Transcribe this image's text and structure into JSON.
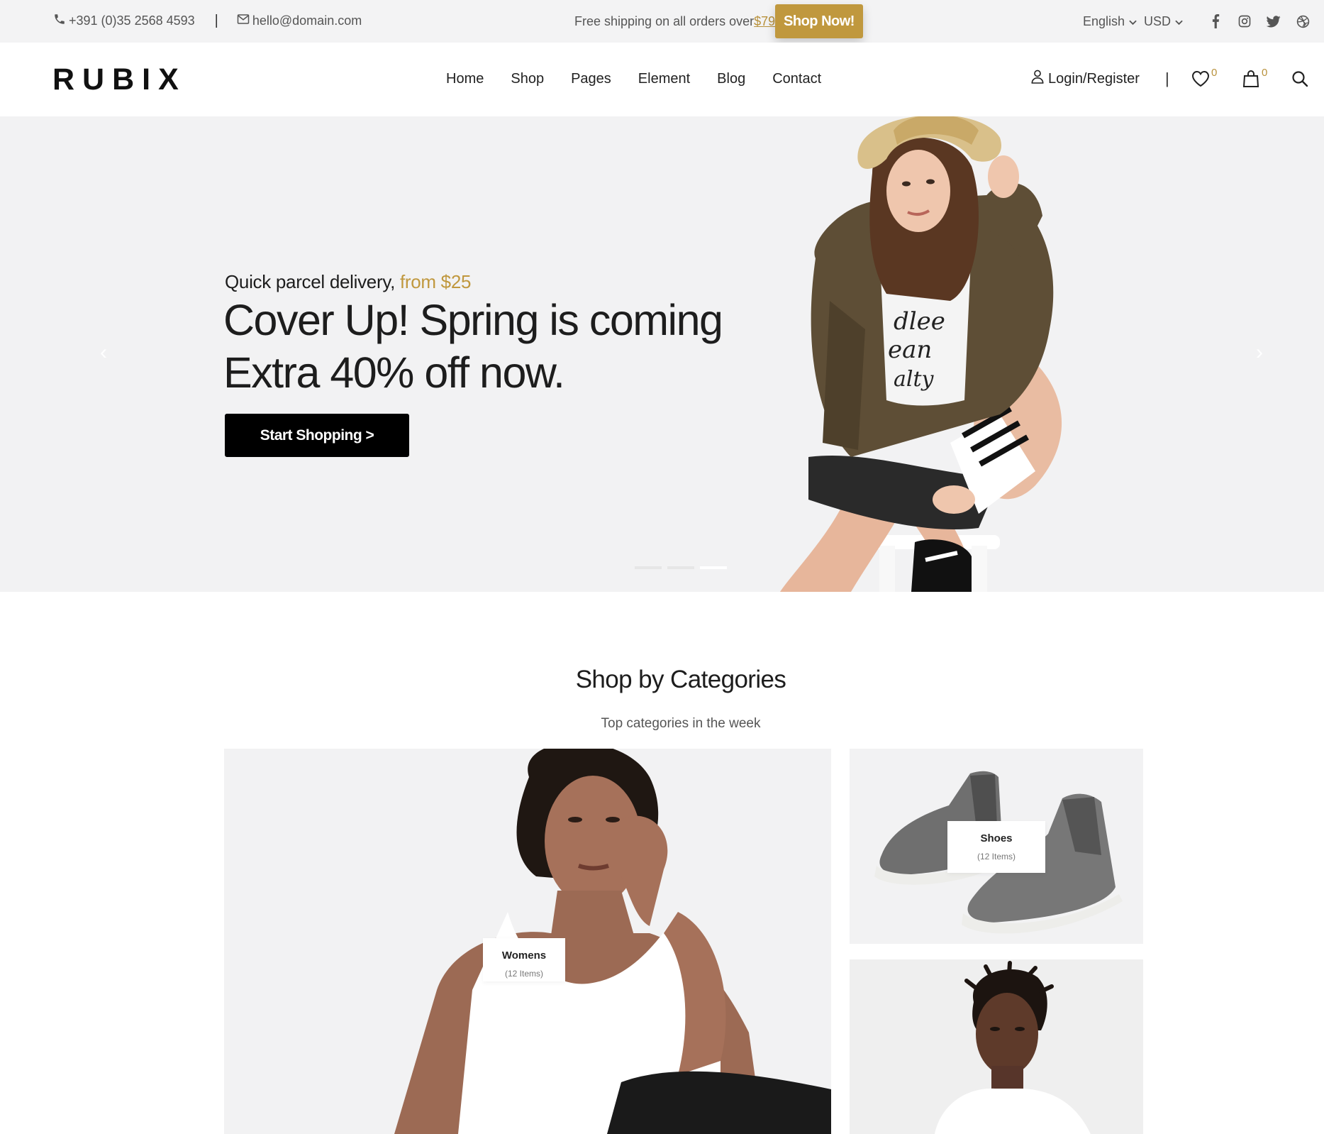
{
  "topbar": {
    "phone": "+391 (0)35 2568 4593",
    "separator": "|",
    "email": "hello@domain.com",
    "promo_text": "Free shipping on all orders over",
    "promo_amount": "$79",
    "shop_now": "Shop Now!",
    "language": "English",
    "currency": "USD",
    "social_icons": [
      "facebook-icon",
      "instagram-icon",
      "twitter-icon",
      "dribbble-icon"
    ]
  },
  "header": {
    "logo": "RUBIX",
    "nav": [
      "Home",
      "Shop",
      "Pages",
      "Element",
      "Blog",
      "Contact"
    ],
    "account": "Login/Register",
    "separator": "|",
    "wishlist_count": "0",
    "cart_count": "0"
  },
  "hero": {
    "subtitle": "Quick parcel delivery,",
    "subtitle_highlight": "from $25",
    "title_line1": "Cover Up! Spring is coming",
    "title_line2": "Extra 40% off now.",
    "cta": "Start Shopping >",
    "prev_arrow": "‹",
    "next_arrow": "›",
    "slides_total": 3,
    "active_slide": 3
  },
  "categories": {
    "title": "Shop by Categories",
    "subtitle": "Top categories in the week",
    "items": [
      {
        "name": "Womens",
        "count": "(12 Items)"
      },
      {
        "name": "Shoes",
        "count": "(12 Items)"
      }
    ]
  },
  "colors": {
    "accent": "#c0983e",
    "hero_bg": "#f2f2f3",
    "topbar_bg": "#f3f3f4",
    "text_dark": "#1d1d1d"
  }
}
